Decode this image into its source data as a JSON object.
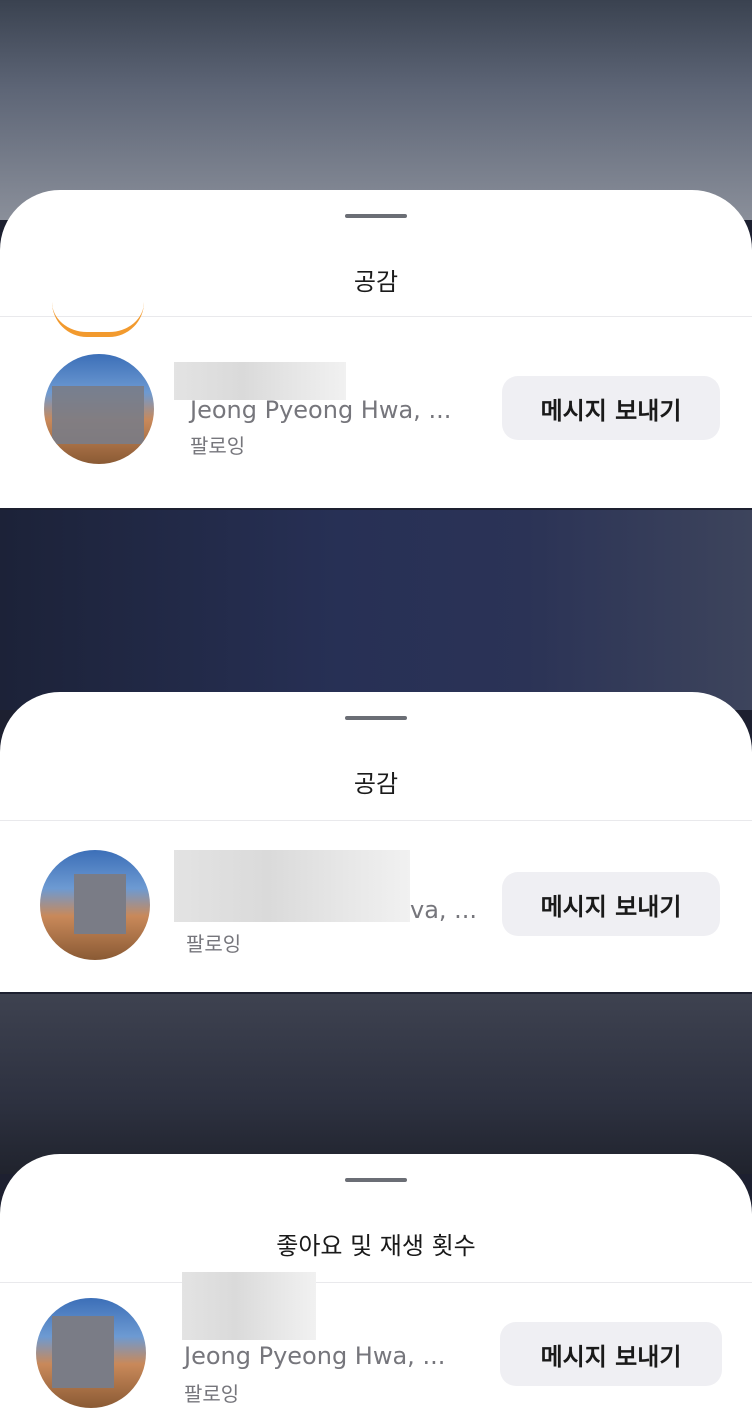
{
  "panels": [
    {
      "sheet_title": "공감",
      "user": {
        "subtitle": "Jeong Pyeong Hwa, ...",
        "status": "팔로잉",
        "action_label": "메시지 보내기"
      }
    },
    {
      "sheet_title": "공감",
      "user": {
        "subtitle": "va, ...",
        "status": "팔로잉",
        "action_label": "메시지 보내기"
      }
    },
    {
      "sheet_title": "좋아요 및 재생 횟수",
      "user": {
        "subtitle": "Jeong Pyeong Hwa, ...",
        "status": "팔로잉",
        "action_label": "메시지 보내기"
      }
    }
  ]
}
